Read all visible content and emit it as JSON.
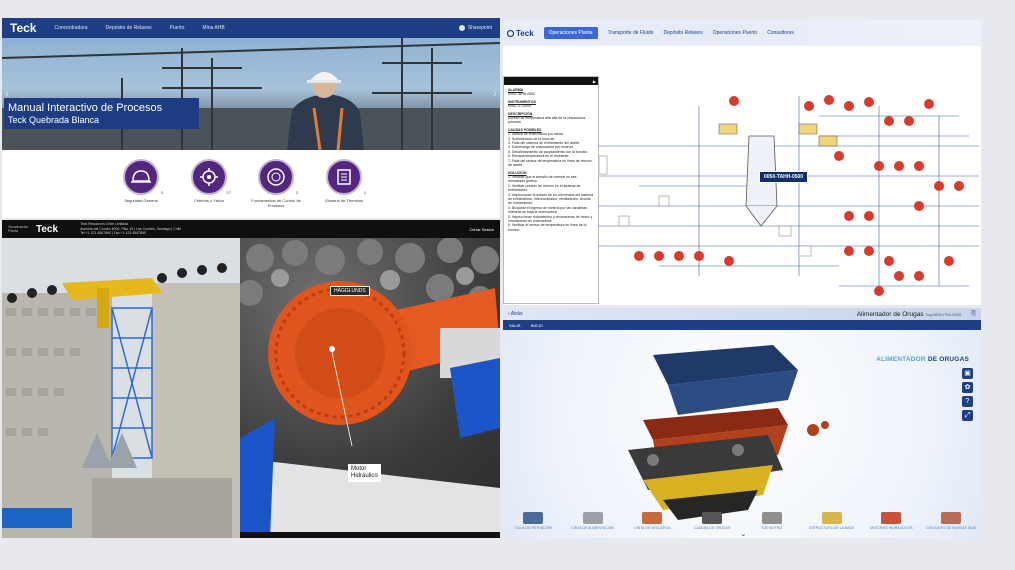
{
  "panel1": {
    "logo": "Teck",
    "nav": [
      "Concentradora",
      "Depósito de Relaves",
      "Puerto",
      "Mina AHB"
    ],
    "sharepoint": "Sharepoint",
    "hero_title": "Manual Interactivo de Procesos",
    "hero_subtitle": "Teck Quebrada Blanca",
    "prev_arrow": "‹",
    "next_arrow": "›",
    "categories": [
      {
        "label": "Seguridad General",
        "count": "3"
      },
      {
        "label": "Criterios y Visión",
        "count": "27"
      },
      {
        "label": "Fundamentos de Control de Procesos",
        "count": "3"
      },
      {
        "label": "Glosario de Términos",
        "count": "1"
      }
    ]
  },
  "panel2": {
    "small_label": "Visualización Planta",
    "logo": "Teck",
    "address_lines": [
      "Teck Resources Chile Limitada",
      "Avenida del Cóndor 6000, Piso 15 | Las Condes, Santiago | Chile",
      "Tel +1 123 4567890 | Fax +1 123 4567890"
    ],
    "close": "Cerrar Sesión",
    "motor_tag": "HÄGGLUNDS",
    "motor_callout": [
      "Motor",
      "Hidráulico"
    ]
  },
  "panel3": {
    "logo": "Teck",
    "nav": [
      "Operaciones Planta",
      "Transporte de Fluido",
      "Depósito Relaves",
      "Operaciones Puerto",
      "Consultores"
    ],
    "alarm_title": "ALARMA",
    "alarm_code": "0050-TAHH-0500",
    "instruments_title": "INSTRUMENTOS",
    "instruments_value": "0050-TIT-0505",
    "description_title": "DESCRIPCIÓN",
    "description": "Exceso de temperatura alta alta de la chancadora primaria",
    "causes_title": "CAUSAS POSIBLES",
    "causes": [
      "1. Alarma de chancadora por inicial.",
      "2. Sobrellenado de la tolva de.",
      "3. Falla del sistema de enfriamiento del aceite.",
      "4. Sobrecarga de chancadora por mineral.",
      "5. Desalineamiento de acoplamiento con la bomba.",
      "6. Elevada temperatura en el ambiente.",
      "7. Falla del sensor de temperatura en línea de retorno de aceite."
    ],
    "solution_title": "SOLUCIÓN",
    "solutions": [
      "1. Verificar que el tamaño de mineral no sea demasiado grueso.",
      "2. Verificar presión de retorno en el sistema de enfriamiento.",
      "3. Inspeccionar el estado de los elementos del sistema de enfriamiento, intercambiador, ventiladores, circuito de enfriamiento.",
      "4. Bloquear el ingreso de mineral por las canaletas mientras se baja la chancadora.",
      "5. Inspeccionar rodamientos y chumaceras de motor y chumaceras de chancadora.",
      "6. Verificar el sensor de temperatura en línea de la bomba."
    ],
    "tag": "0050-TAHH-0500",
    "colors": {
      "alarm_red": "#d93a2b",
      "line": "#3f5fa8"
    }
  },
  "panel4": {
    "back": "Atrás",
    "title": "Alimentador de Orugas",
    "title_tag": "Tag:0050-FEA-0050",
    "bar": [
      "SALIR",
      "INICIO"
    ],
    "big_left": "ALIMENTADOR",
    "big_right": "DE ORUGAS",
    "side_icons": [
      "camera-icon",
      "gear-icon",
      "help-icon",
      "expand-icon"
    ],
    "parts": [
      "TOLVA DE RETENCIÓN",
      "CINTA DE ALIMENTACIÓN",
      "CINTA DE DESCARGA",
      "CADENA DE ORUGAS",
      "EJE MOTRIZ",
      "ESTRUCTURA DE LA BASE",
      "MOTORES HIDRÁULICOS",
      "CONJUNTO DE RUEDAS GUÍA"
    ],
    "chevron": "⌄"
  }
}
